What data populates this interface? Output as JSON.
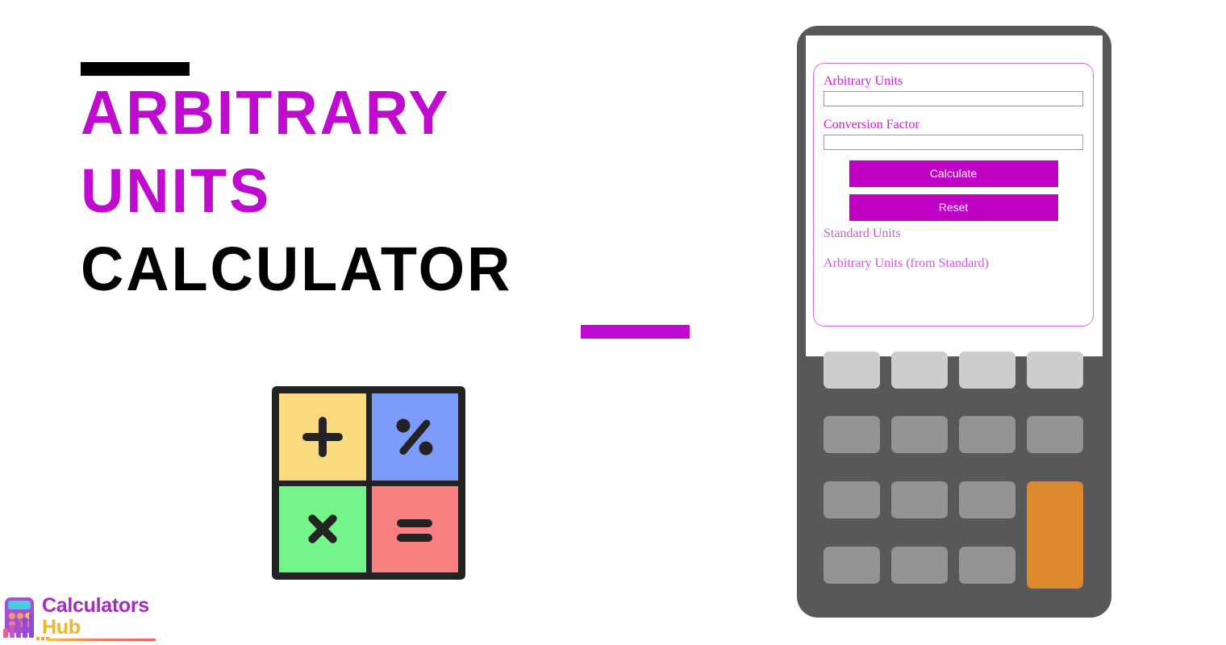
{
  "promo": {
    "title_lines": [
      {
        "text": "Arbitrary",
        "style": "accent"
      },
      {
        "text": "Units",
        "style": "accent"
      },
      {
        "text": "Calculator",
        "style": "dark"
      }
    ],
    "accent_color": "#bf0bd0",
    "dark_color": "#000000",
    "top_rule_color": "#000000",
    "bottom_rule_color": "#bf0bd0"
  },
  "operator_tiles": [
    {
      "name": "plus",
      "glyph": "+",
      "background": "#fadb7e",
      "glyph_color": "#232323"
    },
    {
      "name": "percent",
      "glyph": "%",
      "background": "#7d9bfb",
      "glyph_color": "#232323"
    },
    {
      "name": "multiply",
      "glyph": "×",
      "background": "#73f58c",
      "glyph_color": "#232323"
    },
    {
      "name": "equals",
      "glyph": "=",
      "background": "#f9807f",
      "glyph_color": "#232323"
    }
  ],
  "logo": {
    "word_1": "Calculators",
    "word_2": "Hub",
    "word_1_color": "#a32cc4",
    "word_2_color": "#f0b429"
  },
  "calculator": {
    "fields": [
      {
        "label": "Arbitrary Units",
        "value": "",
        "placeholder": ""
      },
      {
        "label": "Conversion Factor",
        "value": "",
        "placeholder": ""
      }
    ],
    "buttons": [
      {
        "label": "Calculate",
        "name": "calculate-button"
      },
      {
        "label": "Reset",
        "name": "reset-button"
      }
    ],
    "results": [
      {
        "label": "Standard Units"
      },
      {
        "label": "Arbitrary Units (from Standard)"
      }
    ],
    "button_color": "#bf00c4",
    "label_color": "#cc22cc",
    "result_color": "#d15ad8",
    "card_border_color": "#d86fe0"
  },
  "keypad": {
    "body_color": "#58585a",
    "row1_key_color": "#cdcdcd",
    "key_color": "#949496",
    "accent_key_color": "#dd8a2e",
    "rows": 4,
    "columns": 4
  }
}
